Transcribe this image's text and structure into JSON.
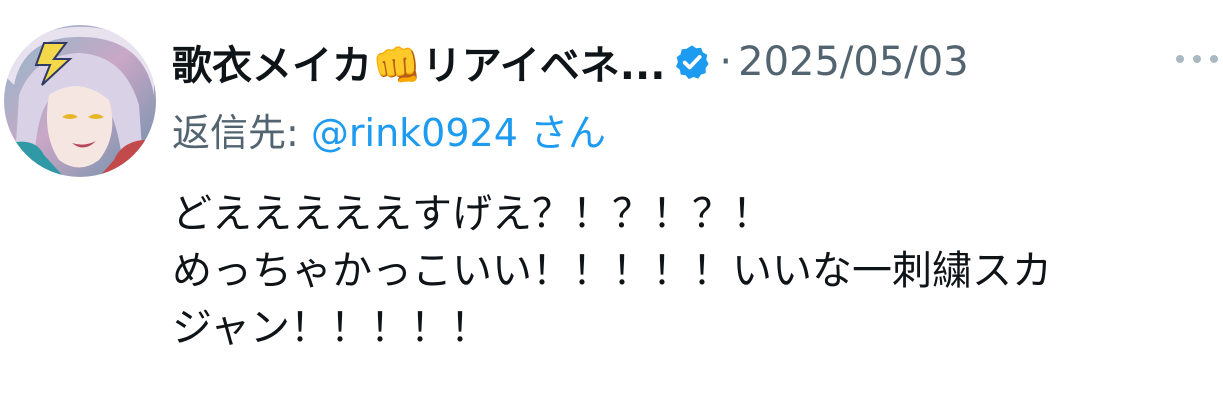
{
  "tweet": {
    "author": {
      "display_name": "歌衣メイカ",
      "emoji": "👊",
      "display_name_suffix": "リアイベネ...",
      "verified_icon": "verified-badge-icon",
      "avatar_icon": "avatar-illustration"
    },
    "separator": "·",
    "timestamp": "2025/05/03",
    "more_icon": "more-dots-icon",
    "reply_to": {
      "prefix": "返信先: ",
      "handle": "@rink0924",
      "suffix": " さん"
    },
    "text_lines": [
      "どえええええすげえ？！？！？！",
      "めっちゃかっこいい！！！！！いいな一刺繍スカ",
      "ジャン！！！！！"
    ]
  },
  "colors": {
    "primary_text": "#0f1419",
    "secondary_text": "#536471",
    "link": "#1d9bf0",
    "verified": "#1d9bf0"
  }
}
